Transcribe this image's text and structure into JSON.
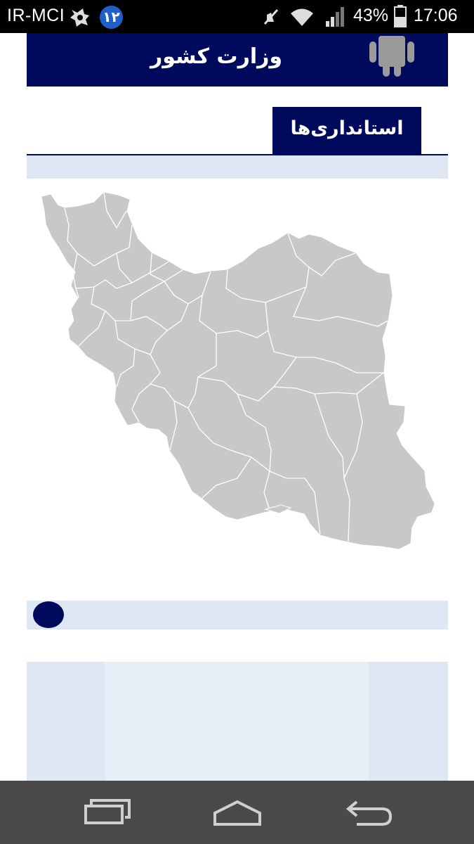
{
  "status_bar": {
    "carrier": "IR-MCI",
    "notification_badge": "۱۲",
    "battery_percent": "43%",
    "time": "17:06"
  },
  "header": {
    "title": "وزارت کشور",
    "logo_icon": "android-robot-icon"
  },
  "section": {
    "tab_label": "استانداری‌ها"
  },
  "map": {
    "subject": "provinces-of-iran",
    "fill_color": "#c8c8c8",
    "border_color": "#ffffff"
  },
  "pager": {
    "active_index": 0
  },
  "navigation": {
    "buttons": [
      "recents-icon",
      "home-icon",
      "back-icon"
    ]
  },
  "colors": {
    "brand": "#000a5c",
    "strip": "#e0e7f4",
    "nav_bar": "#4a4a4a"
  }
}
